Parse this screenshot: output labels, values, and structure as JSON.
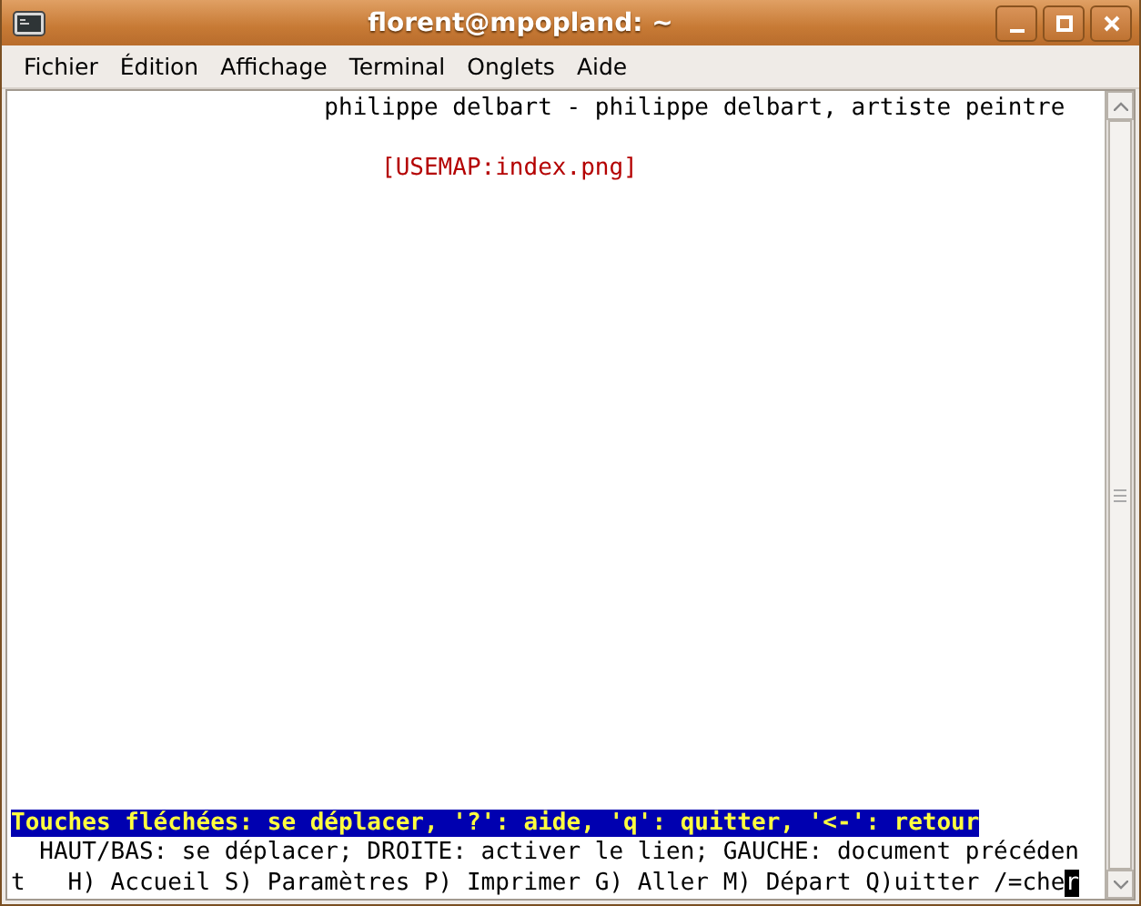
{
  "window": {
    "title": "florent@mpopland: ~"
  },
  "menu": [
    "Fichier",
    "Édition",
    "Affichage",
    "Terminal",
    "Onglets",
    "Aide"
  ],
  "terminal": {
    "top_lines": [
      {
        "kind": "text",
        "text": "                      philippe delbart - philippe delbart, artiste peintre"
      },
      {
        "kind": "link",
        "text": "                          [USEMAP:index.png]"
      }
    ],
    "status_line": "Touches fléchées: se déplacer, '?': aide, 'q': quitter, '<-': retour",
    "help_lines": [
      "  HAUT/BAS: se déplacer; DROITE: activer le lien; GAUCHE: document précéden",
      "t   H) Accueil S) Paramètres P) Imprimer G) Aller M) Départ Q)uitter /=che"
    ],
    "cursor": "r"
  }
}
